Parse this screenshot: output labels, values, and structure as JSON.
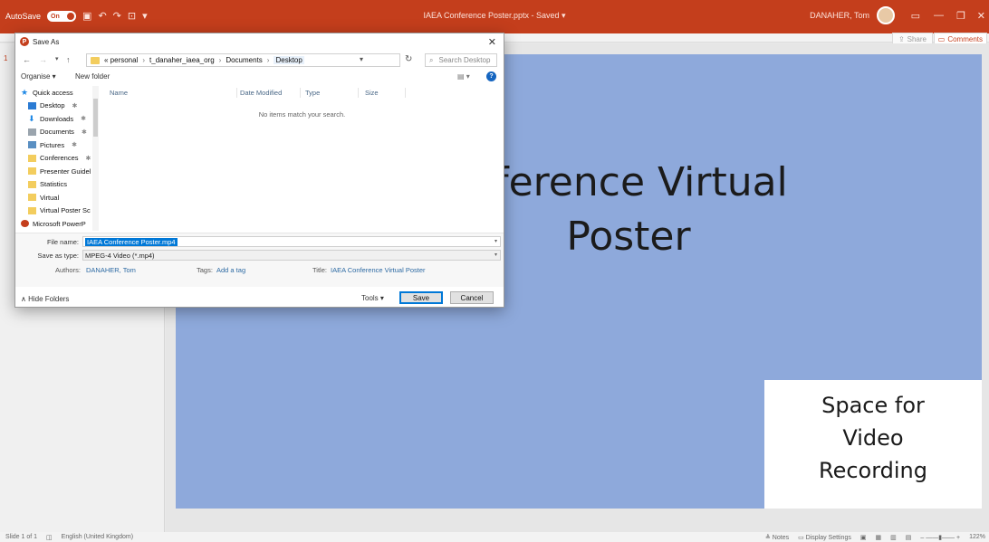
{
  "titlebar": {
    "autosave_label": "AutoSave",
    "autosave_state": "On",
    "doc_title": "IAEA Conference Poster.pptx  -  Saved  ▾",
    "user_name": "DANAHER, Tom"
  },
  "ribbon": {
    "share_label": "Share",
    "comments_label": "Comments"
  },
  "thumbnail_pane": {
    "slide_number": "1"
  },
  "slide": {
    "title_line1": "nference Virtual",
    "title_line2": "Poster",
    "video_box_lines": [
      "Space for",
      "Video",
      "Recording"
    ],
    "background_color": "#8ea9db"
  },
  "dialog": {
    "title": "Save As",
    "breadcrumb": [
      "«  personal",
      "t_danaher_iaea_org",
      "Documents",
      "Desktop"
    ],
    "search_placeholder": "Search Desktop",
    "organise_label": "Organise ▾",
    "new_folder_label": "New folder",
    "nav_items": [
      {
        "label": "Quick access",
        "icon": "star-icon",
        "pinned": false
      },
      {
        "label": "Desktop",
        "icon": "desktop-icon",
        "pinned": true
      },
      {
        "label": "Downloads",
        "icon": "download-icon",
        "pinned": true
      },
      {
        "label": "Documents",
        "icon": "documents-icon",
        "pinned": true
      },
      {
        "label": "Pictures",
        "icon": "pictures-icon",
        "pinned": true
      },
      {
        "label": "Conferences",
        "icon": "folder-icon",
        "pinned": true
      },
      {
        "label": "Presenter Guidel",
        "icon": "folder-icon",
        "pinned": false
      },
      {
        "label": "Statistics",
        "icon": "folder-icon",
        "pinned": false
      },
      {
        "label": "Virtual",
        "icon": "folder-icon",
        "pinned": false
      },
      {
        "label": "Virtual Poster Sc",
        "icon": "folder-icon",
        "pinned": false
      },
      {
        "label": "Microsoft PowerP",
        "icon": "powerpoint-icon",
        "pinned": false
      }
    ],
    "columns": [
      "Name",
      "Date Modified",
      "Type",
      "Size"
    ],
    "empty_message": "No items match your search.",
    "file_name_label": "File name:",
    "file_name_value": "IAEA Conference Poster.mp4",
    "save_as_type_label": "Save as type:",
    "save_as_type_value": "MPEG-4 Video (*.mp4)",
    "authors_label": "Authors:",
    "authors_value": "DANAHER, Tom",
    "tags_label": "Tags:",
    "tags_value": "Add a tag",
    "title_label": "Title:",
    "title_value": "IAEA Conference Virtual Poster",
    "hide_folders_label": "Hide Folders",
    "tools_label": "Tools  ▾",
    "save_label": "Save",
    "cancel_label": "Cancel"
  },
  "statusbar": {
    "slide_info": "Slide 1 of 1",
    "language": "English (United Kingdom)",
    "notes_label": "Notes",
    "display_settings_label": "Display Settings",
    "zoom": "122%"
  }
}
